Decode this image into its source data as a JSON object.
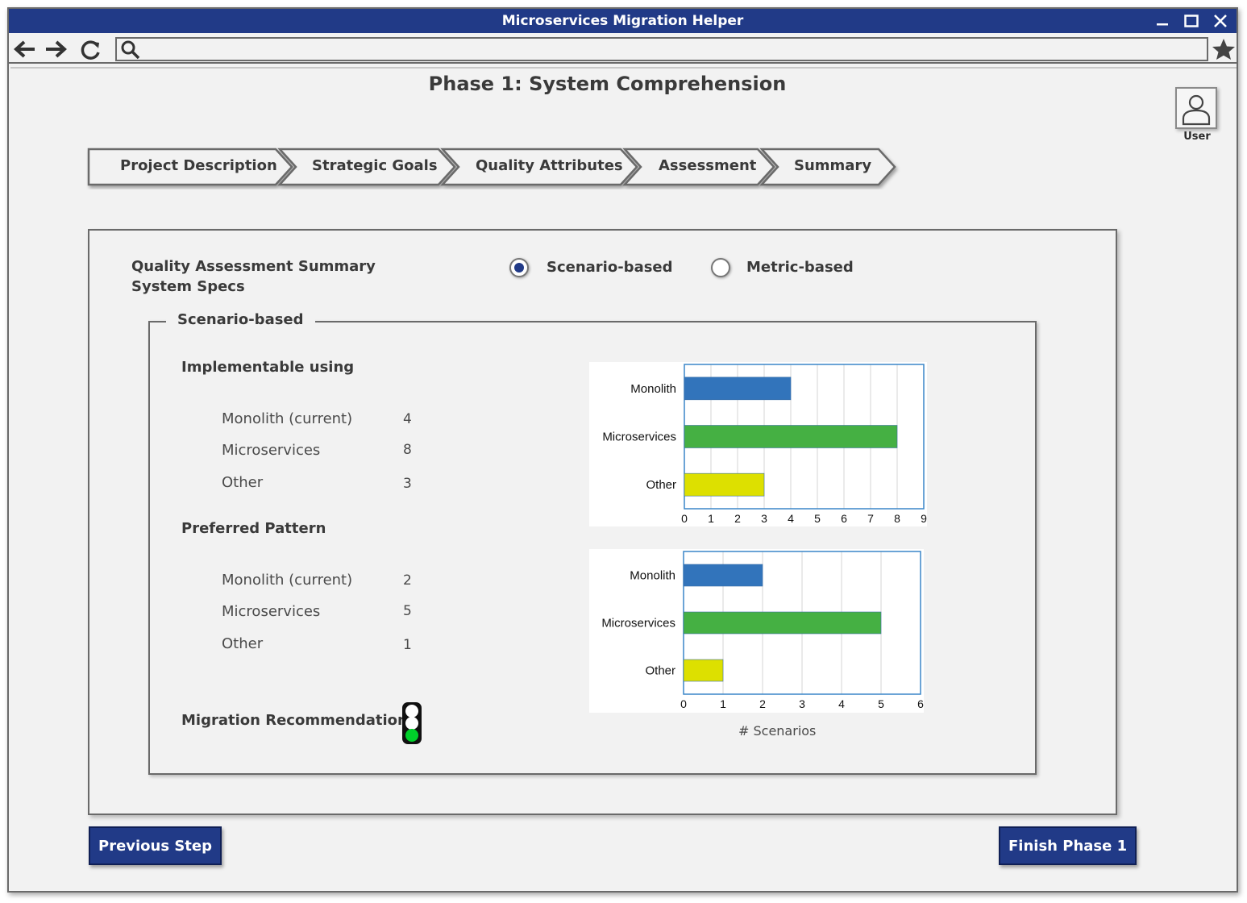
{
  "window": {
    "title": "Microservices Migration Helper"
  },
  "page": {
    "title": "Phase 1: System Comprehension"
  },
  "user": {
    "label": "User"
  },
  "steps": [
    {
      "label": "Project Description"
    },
    {
      "label": "Strategic Goals"
    },
    {
      "label": "Quality Attributes"
    },
    {
      "label": "Assessment"
    },
    {
      "label": "Summary"
    }
  ],
  "panel": {
    "heading_line1": "Quality Assessment Summary",
    "heading_line2": "System Specs",
    "mode_options": [
      {
        "label": "Scenario-based",
        "selected": true
      },
      {
        "label": "Metric-based",
        "selected": false
      }
    ],
    "group_title": "Scenario-based",
    "implementable": {
      "title": "Implementable using",
      "items": [
        {
          "label": "Monolith (current)",
          "value": "4"
        },
        {
          "label": "Microservices",
          "value": "8"
        },
        {
          "label": "Other",
          "value": "3"
        }
      ]
    },
    "preferred": {
      "title": "Preferred Pattern",
      "items": [
        {
          "label": "Monolith (current)",
          "value": "2"
        },
        {
          "label": "Microservices",
          "value": "5"
        },
        {
          "label": "Other",
          "value": "1"
        }
      ]
    },
    "recommendation_label": "Migration Recommendation:",
    "recommendation_signal": "green"
  },
  "chart_data": [
    {
      "type": "bar",
      "orientation": "horizontal",
      "categories": [
        "Monolith",
        "Microservices",
        "Other"
      ],
      "values": [
        4,
        8,
        3
      ],
      "colors": [
        "#3274bb",
        "#45b043",
        "#dde000"
      ],
      "xlim": [
        0,
        9
      ],
      "xticks": [
        "0",
        "1",
        "2",
        "3",
        "4",
        "5",
        "6",
        "7",
        "8",
        "9"
      ],
      "grid": true
    },
    {
      "type": "bar",
      "orientation": "horizontal",
      "categories": [
        "Monolith",
        "Microservices",
        "Other"
      ],
      "values": [
        2,
        5,
        1
      ],
      "colors": [
        "#3274bb",
        "#45b043",
        "#dde000"
      ],
      "xlim": [
        0,
        6
      ],
      "xticks": [
        "0",
        "1",
        "2",
        "3",
        "4",
        "5",
        "6"
      ],
      "xlabel": "# Scenarios",
      "grid": true
    }
  ],
  "buttons": {
    "previous": "Previous Step",
    "finish": "Finish Phase 1"
  },
  "colors": {
    "titlebar": "#213a87",
    "button": "#213a87",
    "accent_green": "#45b043"
  }
}
